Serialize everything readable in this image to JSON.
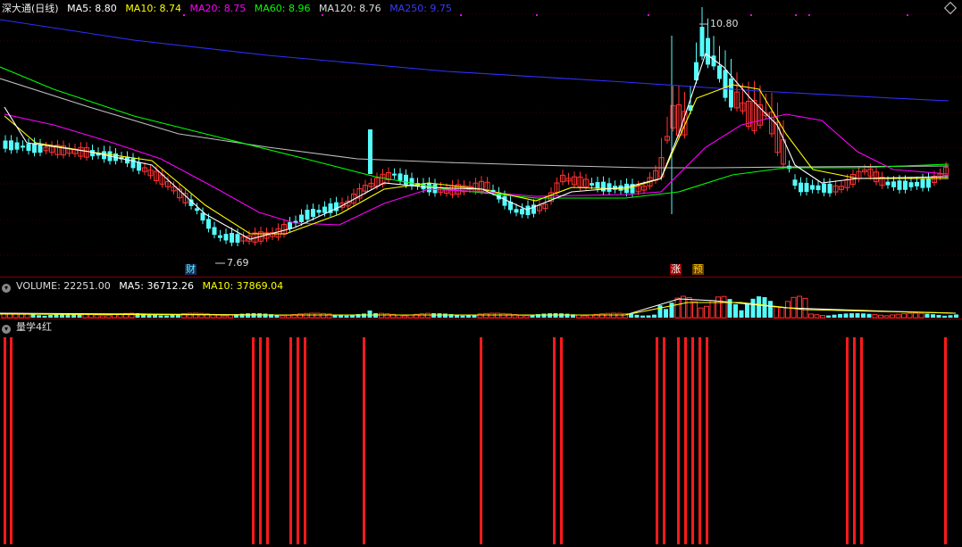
{
  "header": {
    "title": "深大通(日线)",
    "ma5": "MA5: 8.80",
    "ma10": "MA10: 8.74",
    "ma20": "MA20: 8.75",
    "ma60": "MA60: 8.96",
    "ma120": "MA120: 8.76",
    "ma250": "MA250: 9.75"
  },
  "main": {
    "high_label": "10.80",
    "low_label": "7.69",
    "marker_cai": "财",
    "marker_zhang": "涨",
    "marker_yu": "预"
  },
  "volume": {
    "label": "VOLUME: 22251.00",
    "ma5": "MA5: 36712.26",
    "ma10": "MA10: 37869.04"
  },
  "indicator": {
    "title": "量学4红"
  },
  "colors": {
    "up": "#ff3232",
    "down": "#54fcfc",
    "ma5": "#ffffff",
    "ma10": "#ffff00",
    "ma20": "#ff00ff",
    "ma60": "#00ff00",
    "ma120": "#c0c0c0",
    "ma250": "#2f2fff",
    "grid": "#8b0000"
  }
}
